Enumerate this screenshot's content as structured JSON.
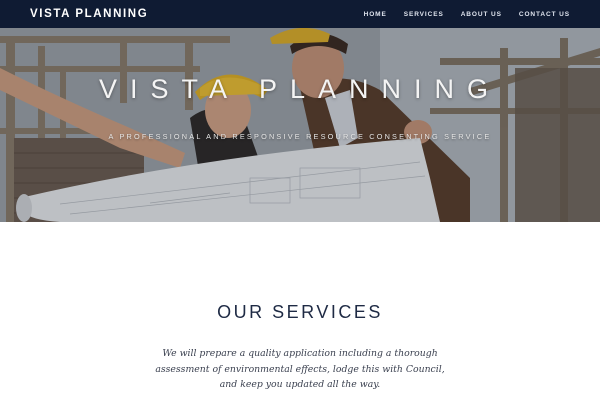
{
  "navbar": {
    "brand": "VISTA PLANNING",
    "links": [
      {
        "label": "HOME"
      },
      {
        "label": "SERVICES"
      },
      {
        "label": "ABOUT US"
      },
      {
        "label": "CONTACT US"
      }
    ],
    "background": "#0f1b33"
  },
  "hero": {
    "title": "VISTA PLANNING",
    "subtitle": "A PROFESSIONAL AND RESPONSIVE RESOURCE CONSENTING SERVICE",
    "image_subject": "two-people-in-hard-hats-holding-blueprints-at-construction-site"
  },
  "services": {
    "heading": "OUR SERVICES",
    "lines": [
      "We will prepare a quality application including a thorough",
      "assessment of environmental effects, lodge this with Council,",
      "and keep you updated all the way."
    ],
    "heading_color": "#1e2a44"
  }
}
